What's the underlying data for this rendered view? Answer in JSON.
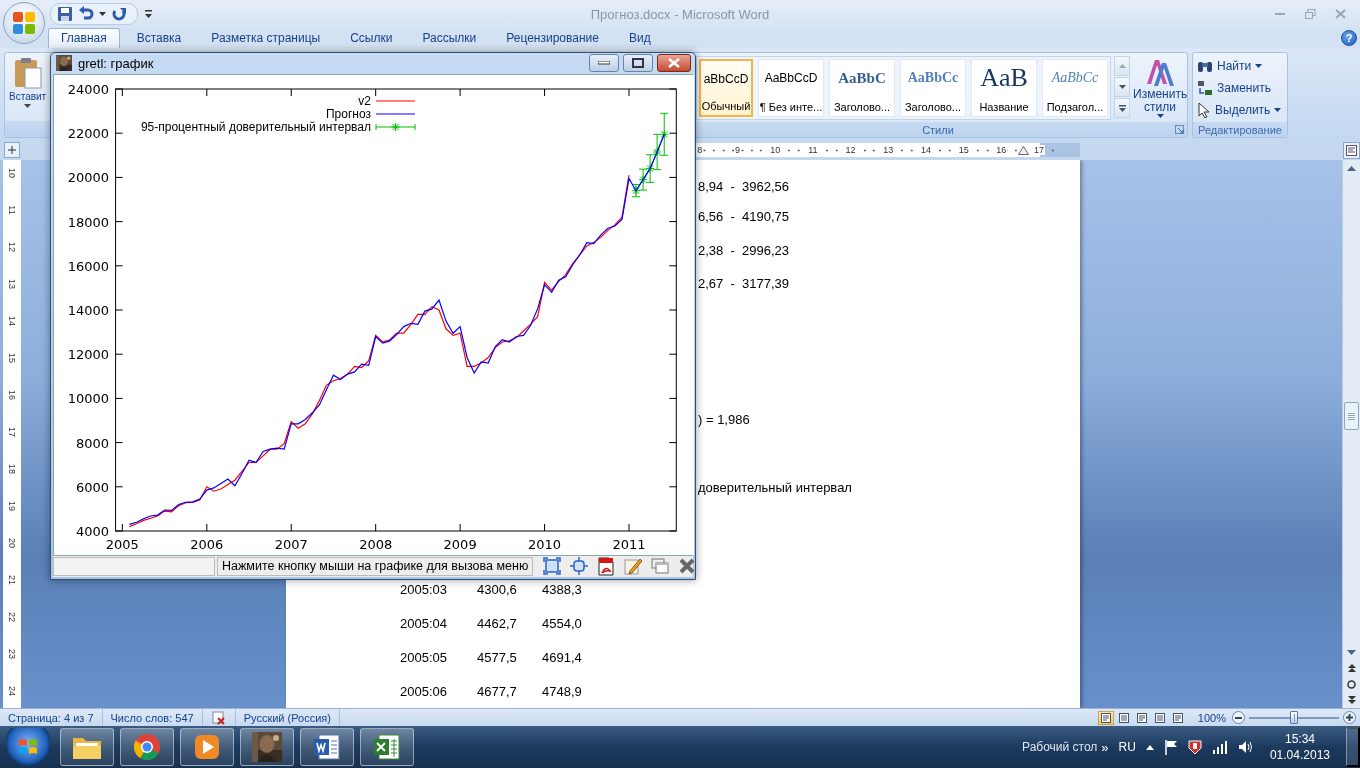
{
  "word_window": {
    "title": "Прогноз.docx - Microsoft Word"
  },
  "tabs": [
    {
      "label": "Главная",
      "selected": true
    },
    {
      "label": "Вставка",
      "selected": false
    },
    {
      "label": "Разметка страницы",
      "selected": false
    },
    {
      "label": "Ссылки",
      "selected": false
    },
    {
      "label": "Рассылки",
      "selected": false
    },
    {
      "label": "Рецензирование",
      "selected": false
    },
    {
      "label": "Вид",
      "selected": false
    }
  ],
  "help": "?",
  "ribbon": {
    "clipboard": {
      "paste_label": "Вставит"
    },
    "styles": {
      "items": [
        {
          "kind": "normal",
          "sample": "aBbCcD",
          "label": "Обычный",
          "selected": true
        },
        {
          "kind": "no_spacing",
          "sample": "AaBbCcD",
          "label": "¶ Без инте...",
          "selected": false
        },
        {
          "kind": "heading1",
          "sample": "AaBbC",
          "label": "Заголово...",
          "selected": false
        },
        {
          "kind": "heading2",
          "sample": "AaBbCc",
          "label": "Заголово...",
          "selected": false
        },
        {
          "kind": "title",
          "sample": "AaB",
          "label": "Название",
          "selected": false
        },
        {
          "kind": "subtitle",
          "sample": "AaBbCc",
          "label": "Подзагол...",
          "selected": false
        }
      ],
      "change_styles": "Изменить стили",
      "group_label": "Стили"
    },
    "editing": {
      "items": [
        {
          "kind": "find",
          "label": "Найти",
          "dropdown": true
        },
        {
          "kind": "replace",
          "label": "Заменить",
          "dropdown": false
        },
        {
          "kind": "select",
          "label": "Выделить",
          "dropdown": true
        }
      ],
      "group_label": "Редактирование"
    }
  },
  "ruler": {
    "numbers": [
      "8",
      "9",
      "10",
      "11",
      "12",
      "13",
      "14",
      "15",
      "16",
      "17"
    ]
  },
  "vertical_ruler": {
    "numbers": [
      "10",
      "11",
      "12",
      "13",
      "14",
      "15",
      "16",
      "17",
      "18",
      "19",
      "20",
      "21",
      "22",
      "23",
      "24"
    ]
  },
  "document": {
    "lines": [
      "8,94  -  3962,56",
      "6,56  -  4190,75",
      "2,38  -  2996,23",
      "2,67  -  3177,39",
      ") = 1,986",
      "доверительный интервал"
    ],
    "table": [
      {
        "period": "2005:03",
        "actual": "4300,6",
        "forecast": "4388,3"
      },
      {
        "period": "2005:04",
        "actual": "4462,7",
        "forecast": "4554,0"
      },
      {
        "period": "2005:05",
        "actual": "4577,5",
        "forecast": "4691,4"
      },
      {
        "period": "2005:06",
        "actual": "4677,7",
        "forecast": "4748,9"
      }
    ]
  },
  "status_bar": {
    "page": "Страница: 4 из 7",
    "words": "Число слов: 547",
    "language": "Русский (Россия)",
    "views": [
      {
        "selected": true
      },
      {
        "selected": false
      },
      {
        "selected": false
      },
      {
        "selected": false
      },
      {
        "selected": false
      }
    ],
    "zoom": "100%",
    "zoom_slider": {
      "level": 0.5
    }
  },
  "taskbar": {
    "apps": [
      {
        "kind": "folder"
      },
      {
        "kind": "browser"
      },
      {
        "kind": "player"
      },
      {
        "kind": "picture"
      },
      {
        "kind": "document"
      },
      {
        "kind": "spreadsheet"
      }
    ],
    "toolbar_label": "Рабочий стол",
    "chevron": "»",
    "language": "RU",
    "time": "15:34",
    "date": "01.04.2013"
  },
  "gretl_window": {
    "title": "gretl: график",
    "status": "Нажмите кнопку мыши на графике для вызова меню",
    "chart_data": {
      "type": "line",
      "xlim": [
        2004.92,
        2011.56
      ],
      "ylim": [
        4000,
        24000
      ],
      "xticks": [
        2005,
        2006,
        2007,
        2008,
        2009,
        2010,
        2011
      ],
      "yticks": [
        4000,
        6000,
        8000,
        10000,
        12000,
        14000,
        16000,
        18000,
        20000,
        22000,
        24000
      ],
      "legend": true,
      "x": [
        2005.083,
        2005.167,
        2005.25,
        2005.333,
        2005.417,
        2005.5,
        2005.583,
        2005.667,
        2005.75,
        2005.833,
        2005.917,
        2006,
        2006.083,
        2006.167,
        2006.25,
        2006.333,
        2006.417,
        2006.5,
        2006.583,
        2006.667,
        2006.75,
        2006.833,
        2006.917,
        2007,
        2007.083,
        2007.167,
        2007.25,
        2007.333,
        2007.417,
        2007.5,
        2007.583,
        2007.667,
        2007.75,
        2007.833,
        2007.917,
        2008,
        2008.083,
        2008.167,
        2008.25,
        2008.333,
        2008.417,
        2008.5,
        2008.583,
        2008.667,
        2008.75,
        2008.833,
        2008.917,
        2009,
        2009.083,
        2009.167,
        2009.25,
        2009.333,
        2009.417,
        2009.5,
        2009.583,
        2009.667,
        2009.75,
        2009.833,
        2009.917,
        2010,
        2010.083,
        2010.167,
        2010.25,
        2010.333,
        2010.417,
        2010.5,
        2010.583,
        2010.667,
        2010.75,
        2010.833,
        2010.917,
        2011,
        2011.083,
        2011.167,
        2011.25,
        2011.333,
        2011.417
      ],
      "series": [
        {
          "name": "v2",
          "color": "#ff0000",
          "values": [
            4200,
            4330,
            4480,
            4580,
            4680,
            4900,
            4870,
            5150,
            5280,
            5300,
            5400,
            6000,
            5800,
            5900,
            6100,
            6300,
            6700,
            7100,
            7100,
            7400,
            7700,
            7700,
            7950,
            8950,
            8650,
            8850,
            9300,
            9900,
            10600,
            10800,
            10900,
            11100,
            11450,
            11400,
            11700,
            12850,
            12550,
            12650,
            12950,
            12950,
            13350,
            13800,
            13800,
            14150,
            14000,
            13150,
            12850,
            12950,
            11450,
            11450,
            11600,
            11850,
            12300,
            12550,
            12600,
            12750,
            13050,
            13350,
            13700,
            15250,
            14900,
            15300,
            15600,
            16100,
            16500,
            16900,
            17050,
            17300,
            17600,
            17850,
            18200,
            20100,
            null,
            null,
            null,
            null,
            null
          ]
        },
        {
          "name": "Прогноз",
          "color": "#0000ff",
          "values": [
            4300,
            4400,
            4550,
            4680,
            4720,
            4950,
            4930,
            5200,
            5300,
            5320,
            5450,
            5850,
            5950,
            6150,
            6350,
            6050,
            6600,
            7200,
            7100,
            7600,
            7700,
            7750,
            7700,
            8850,
            8850,
            9050,
            9350,
            9700,
            10400,
            11050,
            10850,
            11100,
            11200,
            11550,
            11500,
            12800,
            12500,
            12600,
            12900,
            13250,
            13400,
            13350,
            13950,
            14050,
            14450,
            13500,
            12950,
            13250,
            11850,
            11150,
            11650,
            11600,
            12350,
            12650,
            12550,
            12800,
            12850,
            13300,
            14050,
            15150,
            14800,
            15350,
            15500,
            16050,
            16500,
            17050,
            17000,
            17400,
            17700,
            17800,
            18100,
            19950,
            19400,
            19900,
            20400,
            21150,
            21950
          ]
        },
        {
          "name": "95-процентный доверительный интервал",
          "color": "#00c000",
          "marker": "cross",
          "values": [
            null,
            null,
            null,
            null,
            null,
            null,
            null,
            null,
            null,
            null,
            null,
            null,
            null,
            null,
            null,
            null,
            null,
            null,
            null,
            null,
            null,
            null,
            null,
            null,
            null,
            null,
            null,
            null,
            null,
            null,
            null,
            null,
            null,
            null,
            null,
            null,
            null,
            null,
            null,
            null,
            null,
            null,
            null,
            null,
            null,
            null,
            null,
            null,
            null,
            null,
            null,
            null,
            null,
            null,
            null,
            null,
            null,
            null,
            null,
            null,
            null,
            null,
            null,
            null,
            null,
            null,
            null,
            null,
            null,
            null,
            null,
            null,
            19400,
            19900,
            20400,
            21150,
            21950
          ],
          "errors": [
            null,
            null,
            null,
            null,
            null,
            null,
            null,
            null,
            null,
            null,
            null,
            null,
            null,
            null,
            null,
            null,
            null,
            null,
            null,
            null,
            null,
            null,
            null,
            null,
            null,
            null,
            null,
            null,
            null,
            null,
            null,
            null,
            null,
            null,
            null,
            null,
            null,
            null,
            null,
            null,
            null,
            null,
            null,
            null,
            null,
            null,
            null,
            null,
            null,
            null,
            null,
            null,
            null,
            null,
            null,
            null,
            null,
            null,
            null,
            null,
            null,
            null,
            null,
            null,
            null,
            null,
            null,
            null,
            null,
            null,
            null,
            null,
            275,
            475,
            625,
            800,
            950
          ]
        }
      ]
    }
  }
}
